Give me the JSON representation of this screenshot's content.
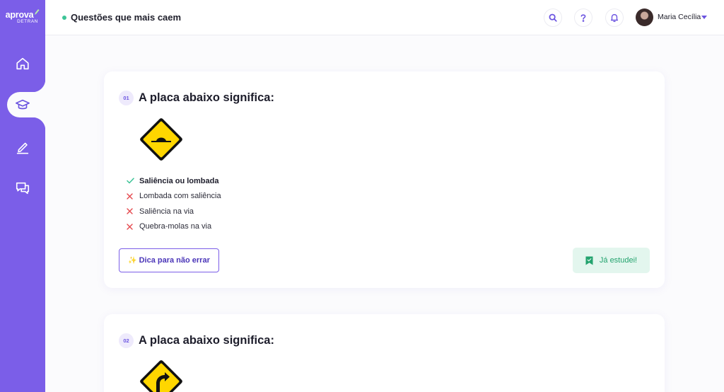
{
  "app": {
    "logo_main": "aprova",
    "logo_sub": "DETRAN"
  },
  "header": {
    "title": "Questões que mais caem",
    "user_name": "Maria Cecília"
  },
  "colors": {
    "sidebar": "#7b5ee8",
    "accent": "#6b54e0",
    "success": "#3dc497",
    "error": "#e5484d",
    "sign_yellow": "#ffd600"
  },
  "icons": {
    "nav": [
      "home-icon",
      "graduation-cap-icon",
      "pen-icon",
      "chat-icon"
    ],
    "header": [
      "search-icon",
      "question-icon",
      "bell-icon"
    ]
  },
  "questions": [
    {
      "number": "01",
      "text": "A placa abaixo significa:",
      "sign": "speed-bump-sign",
      "answers": [
        {
          "label": "Saliência ou lombada",
          "correct": true
        },
        {
          "label": "Lombada com saliência",
          "correct": false
        },
        {
          "label": "Saliência na via",
          "correct": false
        },
        {
          "label": "Quebra-molas na via",
          "correct": false
        }
      ],
      "tip_label": "Dica para não errar",
      "tip_icon": "✨",
      "studied_label": "Já estudei!"
    },
    {
      "number": "02",
      "text": "A placa abaixo significa:",
      "sign": "curve-right-sign"
    }
  ]
}
